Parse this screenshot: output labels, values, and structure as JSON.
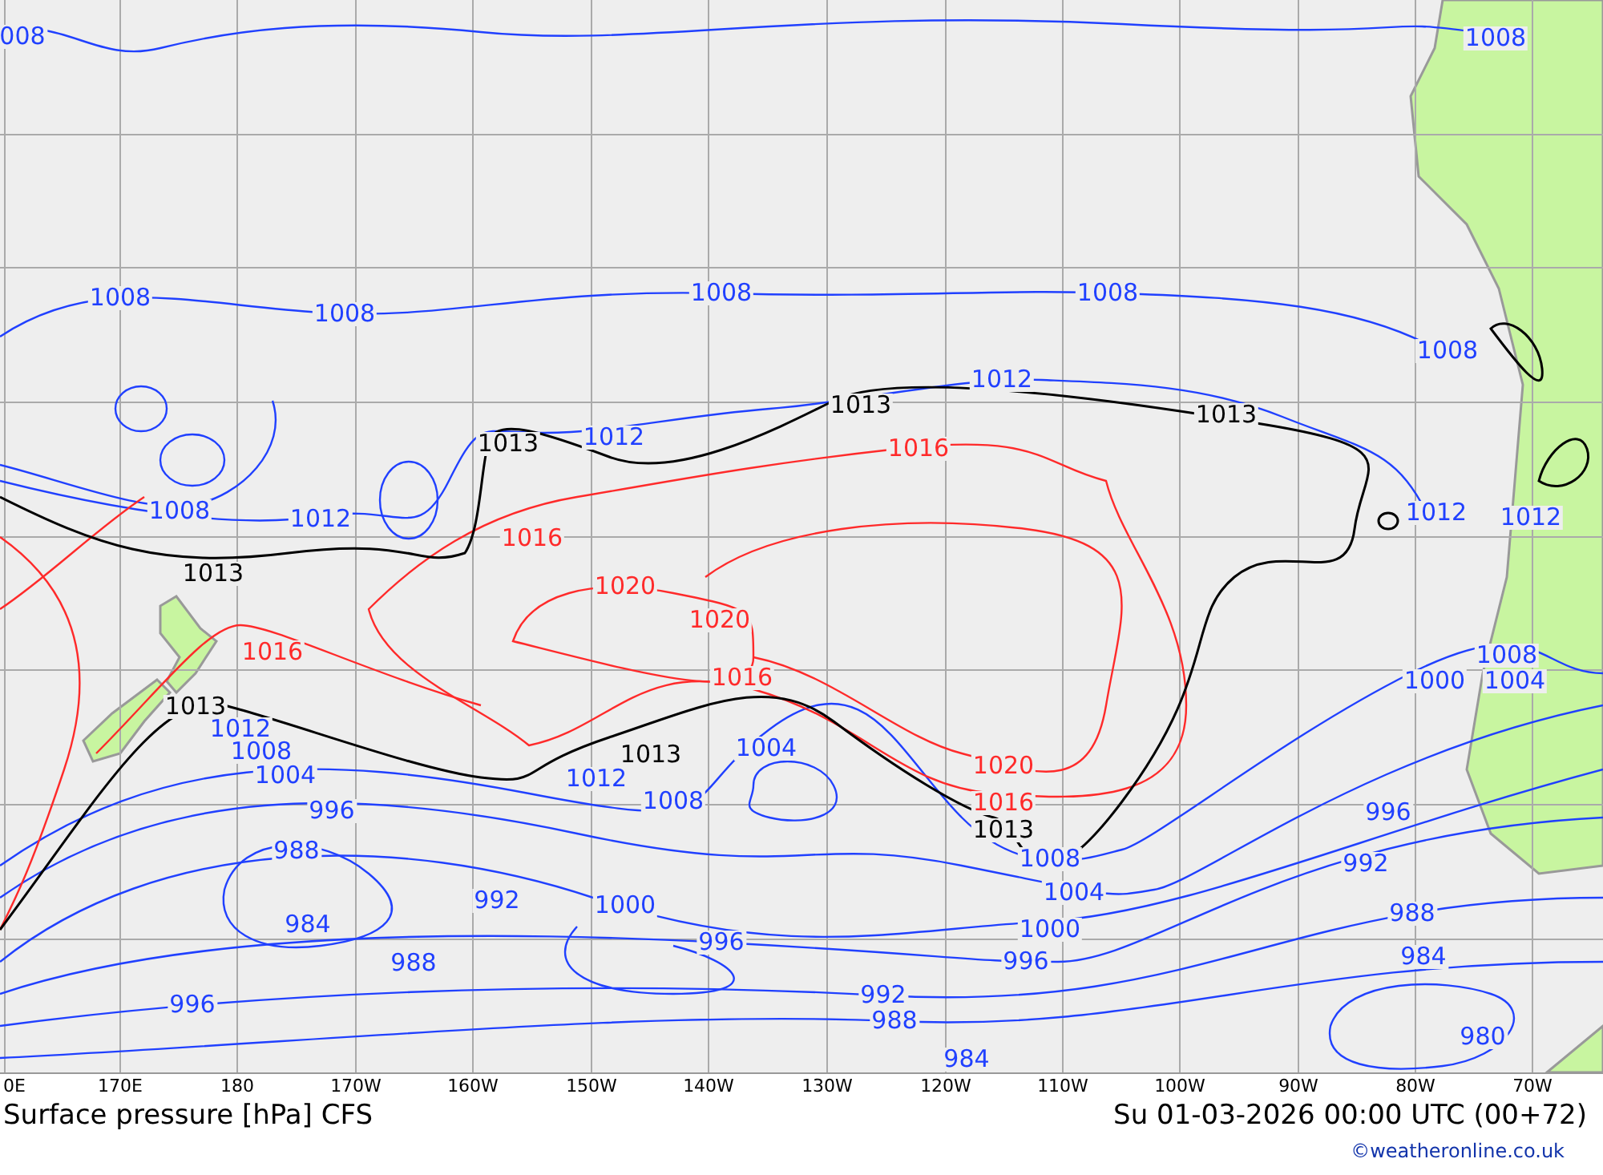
{
  "map": {
    "isobar_labels": [
      {
        "text": "008",
        "kind": "below"
      },
      {
        "text": "1008",
        "kind": "below"
      },
      {
        "text": "1008",
        "kind": "below"
      },
      {
        "text": "1008",
        "kind": "below"
      },
      {
        "text": "1008",
        "kind": "below"
      },
      {
        "text": "1008",
        "kind": "below"
      },
      {
        "text": "1008",
        "kind": "below"
      },
      {
        "text": "1012",
        "kind": "below"
      },
      {
        "text": "1012",
        "kind": "below"
      },
      {
        "text": "1012",
        "kind": "below"
      },
      {
        "text": "1008",
        "kind": "below"
      },
      {
        "text": "1012",
        "kind": "below"
      },
      {
        "text": "1012",
        "kind": "below"
      },
      {
        "text": "1008",
        "kind": "below"
      },
      {
        "text": "1000",
        "kind": "below"
      },
      {
        "text": "1004",
        "kind": "below"
      },
      {
        "text": "1012",
        "kind": "below"
      },
      {
        "text": "1008",
        "kind": "below"
      },
      {
        "text": "1004",
        "kind": "below"
      },
      {
        "text": "996",
        "kind": "below"
      },
      {
        "text": "988",
        "kind": "below"
      },
      {
        "text": "984",
        "kind": "below"
      },
      {
        "text": "992",
        "kind": "below"
      },
      {
        "text": "996",
        "kind": "below"
      },
      {
        "text": "988",
        "kind": "below"
      },
      {
        "text": "1004",
        "kind": "below"
      },
      {
        "text": "1012",
        "kind": "below"
      },
      {
        "text": "1008",
        "kind": "below"
      },
      {
        "text": "1000",
        "kind": "below"
      },
      {
        "text": "996",
        "kind": "below"
      },
      {
        "text": "992",
        "kind": "below"
      },
      {
        "text": "988",
        "kind": "below"
      },
      {
        "text": "984",
        "kind": "below"
      },
      {
        "text": "1008",
        "kind": "below"
      },
      {
        "text": "1004",
        "kind": "below"
      },
      {
        "text": "1000",
        "kind": "below"
      },
      {
        "text": "996",
        "kind": "below"
      },
      {
        "text": "996",
        "kind": "below"
      },
      {
        "text": "992",
        "kind": "below"
      },
      {
        "text": "988",
        "kind": "below"
      },
      {
        "text": "984",
        "kind": "below"
      },
      {
        "text": "980",
        "kind": "below"
      },
      {
        "text": "1016",
        "kind": "above"
      },
      {
        "text": "1016",
        "kind": "above"
      },
      {
        "text": "1020",
        "kind": "above"
      },
      {
        "text": "1020",
        "kind": "above"
      },
      {
        "text": "1016",
        "kind": "above"
      },
      {
        "text": "1016",
        "kind": "above"
      },
      {
        "text": "1020",
        "kind": "above"
      },
      {
        "text": "1016",
        "kind": "above"
      },
      {
        "text": "1013",
        "kind": "reference"
      },
      {
        "text": "1013",
        "kind": "reference"
      },
      {
        "text": "1013",
        "kind": "reference"
      },
      {
        "text": "1013",
        "kind": "reference"
      },
      {
        "text": "1013",
        "kind": "reference"
      },
      {
        "text": "1013",
        "kind": "reference"
      },
      {
        "text": "1013",
        "kind": "reference"
      }
    ],
    "longitudes": [
      "0E",
      "170E",
      "180",
      "170W",
      "160W",
      "150W",
      "140W",
      "130W",
      "120W",
      "110W",
      "100W",
      "90W",
      "80W",
      "70W"
    ]
  },
  "title": "Surface pressure [hPa] CFS",
  "timestamp": "Su 01-03-2026 00:00 UTC (00+72)",
  "credit": "©weatheronline.co.uk"
}
